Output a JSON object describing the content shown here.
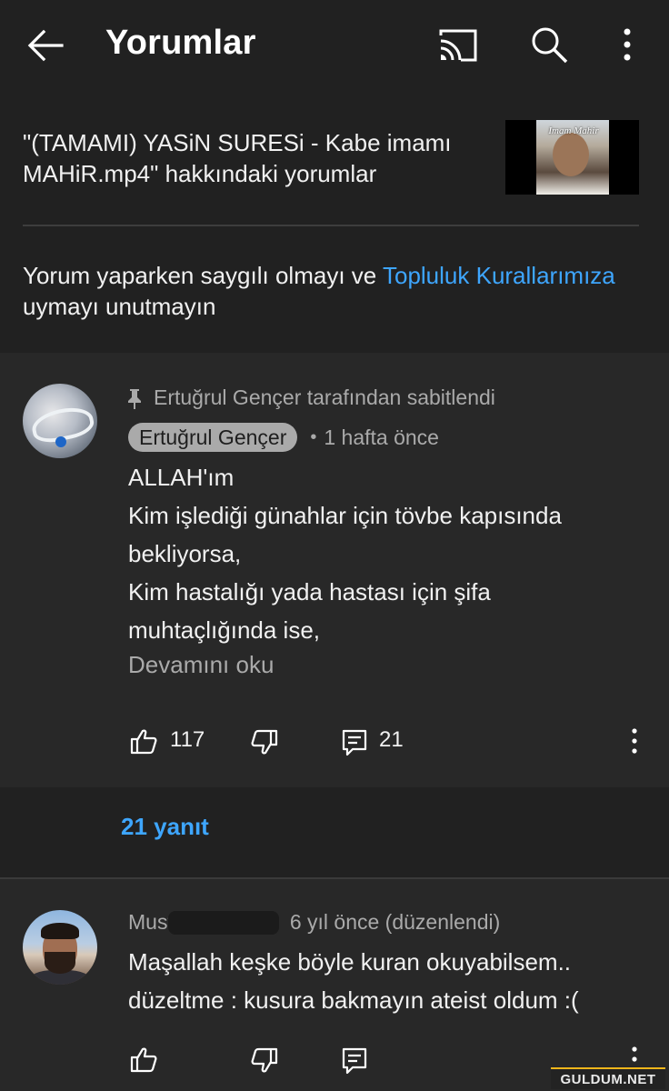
{
  "topbar": {
    "title": "Yorumlar",
    "icons": [
      "back-arrow-icon",
      "cast-icon",
      "search-icon",
      "more-vert-icon"
    ]
  },
  "video": {
    "title": "\"(TAMAMI) YASiN SURESi - Kabe imamı MAHiR.mp4\" hakkındaki yorumlar",
    "thumbnail_text": "Imam Mahir"
  },
  "guideline": {
    "prefix": "Yorum yaparken saygılı olmayı ve ",
    "link": "Topluluk Kurallarımıza",
    "suffix": " uymayı unutmayın"
  },
  "pinned_comment": {
    "pinned_label": "Ertuğrul Gençer tarafından sabitlendi",
    "author": "Ertuğrul Gençer",
    "time": "1 hafta önce",
    "text": "ALLAH'ım\nKim işlediği günahlar için tövbe kapısında bekliyorsa,\nKim hastalığı yada hastası için şifa muhtaçlığında ise,",
    "read_more": "Devamını oku",
    "likes": "117",
    "replies_count": "21"
  },
  "replies_link": "21 yanıt",
  "second_comment": {
    "author": "Must",
    "meta": "6 yıl önce (düzenlendi)",
    "text": "Maşallah keşke böyle kuran okuyabilsem..\ndüzeltme : kusura bakmayın ateist oldum :("
  },
  "watermark": "GULDUM.NET",
  "colors": {
    "background": "#282828",
    "header_bg": "#212121",
    "link": "#3ea6ff",
    "secondary_text": "#aaaaaa"
  }
}
